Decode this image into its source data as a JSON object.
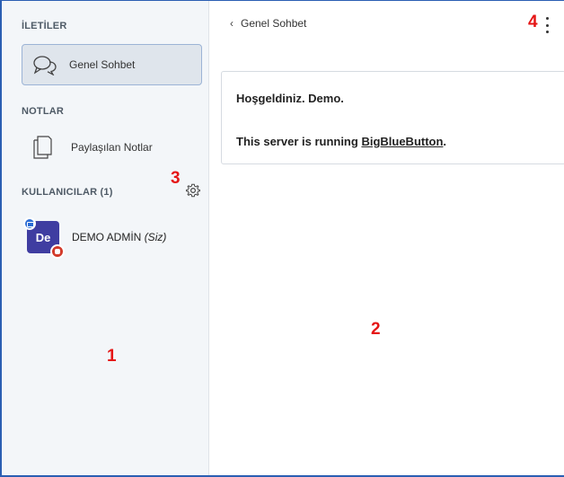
{
  "sidebar": {
    "messages_title": "İLETİLER",
    "chat_item_label": "Genel Sohbet",
    "notes_title": "NOTLAR",
    "notes_item_label": "Paylaşılan Notlar",
    "users_title": "KULLANICILAR (1)",
    "user": {
      "avatar_initials": "De",
      "name": "DEMO ADMİN",
      "you_label": "(Siz)"
    }
  },
  "main": {
    "back_label": "Genel Sohbet",
    "welcome_line1": "Hoşgeldiniz. Demo.",
    "welcome_line2_prefix": "This server is running ",
    "welcome_link": "BigBlueButton",
    "welcome_line2_suffix": "."
  },
  "annotations": [
    "1",
    "2",
    "3",
    "4"
  ],
  "colors": {
    "frame_border": "#2b5fb3",
    "annotation_red": "#e51616",
    "avatar_bg": "#3f3da1",
    "sidebar_bg": "#f3f6f9"
  },
  "icons": [
    "chat-bubbles-icon",
    "document-icon",
    "gear-icon",
    "chevron-left-icon",
    "kebab-menu-icon"
  ]
}
